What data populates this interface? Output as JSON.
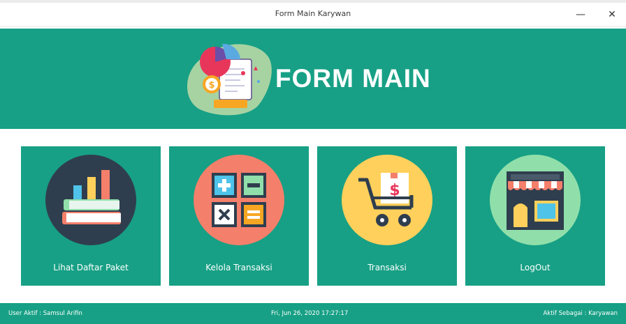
{
  "window": {
    "title": "Form Main Karywan",
    "minimize_glyph": "—",
    "close_glyph": "✕"
  },
  "header": {
    "title": "FORM MAIN",
    "logo_icon": "invoice-chart-dollar-icon"
  },
  "menu": [
    {
      "label": "Lihat Daftar Paket",
      "icon": "books-chart-icon"
    },
    {
      "label": "Kelola Transaksi",
      "icon": "calculator-icon"
    },
    {
      "label": "Transaksi",
      "icon": "shopping-cart-icon"
    },
    {
      "label": "LogOut",
      "icon": "store-icon"
    }
  ],
  "status": {
    "user": "User Aktif : Samsul Arifin",
    "datetime": "Fri, Jun 26, 2020 17:27:17",
    "role": "Aktif Sebagai : Karyawan"
  },
  "colors": {
    "primary": "#17a085",
    "tile1_circle": "#2f3e4e",
    "tile2_circle": "#f47f6b",
    "tile3_circle": "#ffd05b",
    "tile4_circle": "#90dfaa"
  }
}
